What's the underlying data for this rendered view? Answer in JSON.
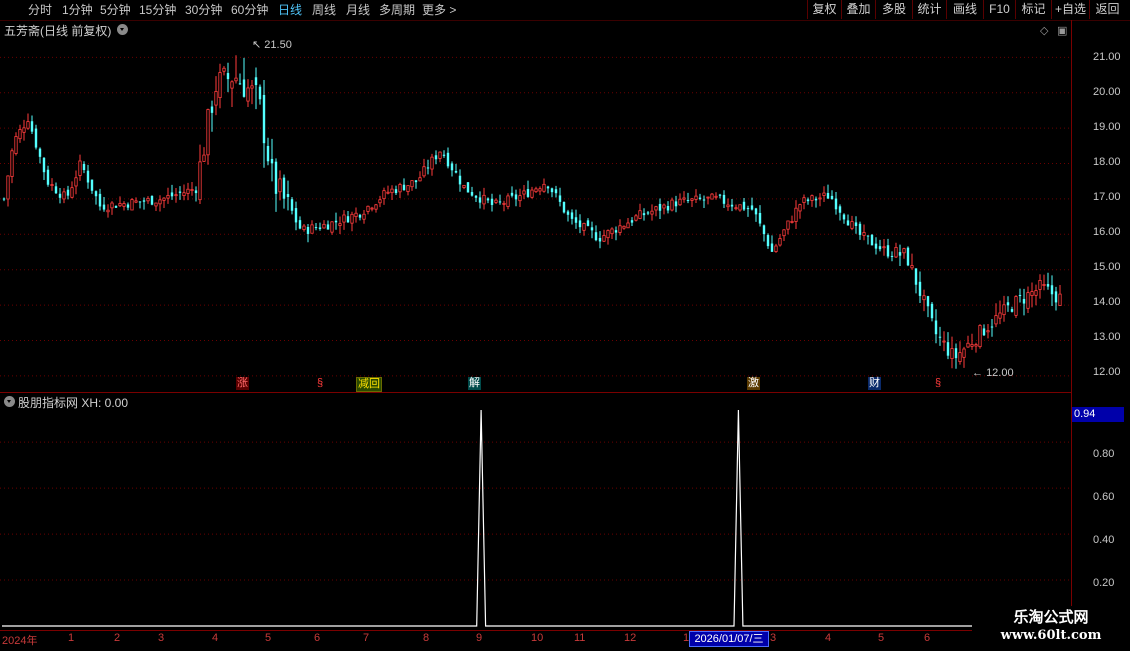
{
  "toolbar": {
    "periods": [
      "分时",
      "1分钟",
      "5分钟",
      "15分钟",
      "30分钟",
      "60分钟",
      "日线",
      "周线",
      "月线",
      "多周期",
      "更多 >"
    ],
    "active_period": "日线",
    "buttons": [
      "复权",
      "叠加",
      "多股",
      "统计",
      "画线",
      "F10",
      "标记",
      "+自选",
      "返回"
    ]
  },
  "main_panel": {
    "title": "五芳斋(日线 前复权)",
    "high_label": "21.50",
    "low_label": "12.00",
    "y_ticks": [
      "21.00",
      "20.00",
      "19.00",
      "18.00",
      "17.00",
      "16.00",
      "15.00",
      "14.00",
      "13.00",
      "12.00"
    ],
    "events": [
      "涨",
      "§",
      "减回",
      "解",
      "激",
      "财",
      "§"
    ]
  },
  "sub_panel": {
    "title": "股朋指标网 XH: 0.00",
    "current_value": "0.94",
    "y_ticks": [
      "0.80",
      "0.60",
      "0.40",
      "0.20"
    ]
  },
  "x_axis": {
    "year": "2024年",
    "months": [
      "1",
      "2",
      "3",
      "4",
      "5",
      "6",
      "7",
      "8",
      "9",
      "10",
      "11",
      "12",
      "1",
      "3",
      "4",
      "5",
      "6"
    ],
    "cursor_date": "2026/01/07/三"
  },
  "watermark": {
    "line1": "乐淘公式网",
    "line2": "www.60lt.com"
  },
  "colors": {
    "up": "#ff3c3c",
    "down": "#54ffff",
    "active": "#4fc3f7",
    "grid": "#7a0000",
    "accent": "#0000aa"
  },
  "chart_data": [
    {
      "type": "candlestick",
      "title": "五芳斋(日线 前复权)",
      "ylim": [
        11.6,
        22.0
      ],
      "y_ticks": [
        21,
        20,
        19,
        18,
        17,
        16,
        15,
        14,
        13,
        12
      ],
      "max": 21.5,
      "min": 12.0,
      "close_path": [
        {
          "t": 0,
          "v": 17.0
        },
        {
          "t": 2,
          "v": 18.6
        },
        {
          "t": 5,
          "v": 19.3
        },
        {
          "t": 9,
          "v": 17.5
        },
        {
          "t": 13,
          "v": 17.0
        },
        {
          "t": 16,
          "v": 18.0
        },
        {
          "t": 20,
          "v": 16.8
        },
        {
          "t": 27,
          "v": 16.9
        },
        {
          "t": 33,
          "v": 17.0
        },
        {
          "t": 40,
          "v": 17.3
        },
        {
          "t": 44,
          "v": 20.2
        },
        {
          "t": 48,
          "v": 20.5
        },
        {
          "t": 53,
          "v": 19.8
        },
        {
          "t": 56,
          "v": 17.5
        },
        {
          "t": 62,
          "v": 16.1
        },
        {
          "t": 68,
          "v": 16.3
        },
        {
          "t": 74,
          "v": 16.6
        },
        {
          "t": 80,
          "v": 17.2
        },
        {
          "t": 86,
          "v": 17.5
        },
        {
          "t": 91,
          "v": 18.4
        },
        {
          "t": 96,
          "v": 17.3
        },
        {
          "t": 102,
          "v": 16.8
        },
        {
          "t": 108,
          "v": 17.1
        },
        {
          "t": 113,
          "v": 17.5
        },
        {
          "t": 118,
          "v": 16.4
        },
        {
          "t": 124,
          "v": 15.9
        },
        {
          "t": 132,
          "v": 16.5
        },
        {
          "t": 140,
          "v": 16.9
        },
        {
          "t": 148,
          "v": 17.0
        },
        {
          "t": 156,
          "v": 16.7
        },
        {
          "t": 160,
          "v": 15.5
        },
        {
          "t": 166,
          "v": 16.9
        },
        {
          "t": 172,
          "v": 17.1
        },
        {
          "t": 178,
          "v": 16.0
        },
        {
          "t": 184,
          "v": 15.5
        },
        {
          "t": 188,
          "v": 15.4
        },
        {
          "t": 194,
          "v": 13.2
        },
        {
          "t": 198,
          "v": 12.5
        },
        {
          "t": 204,
          "v": 13.3
        },
        {
          "t": 210,
          "v": 14.0
        },
        {
          "t": 216,
          "v": 14.5
        },
        {
          "t": 220,
          "v": 14.2
        }
      ]
    },
    {
      "type": "line",
      "title": "股朋指标网 XH: 0.00",
      "ylim": [
        0,
        0.94
      ],
      "y_ticks": [
        0.8,
        0.6,
        0.4,
        0.2
      ],
      "series": [
        {
          "name": "XH",
          "points": [
            {
              "t": 0,
              "v": 0
            },
            {
              "t": 107,
              "v": 0
            },
            {
              "t": 108,
              "v": 1.0
            },
            {
              "t": 109,
              "v": 0
            },
            {
              "t": 165,
              "v": 0
            },
            {
              "t": 166,
              "v": 1.0
            },
            {
              "t": 167,
              "v": 0
            },
            {
              "t": 220,
              "v": 0
            }
          ]
        }
      ]
    }
  ]
}
